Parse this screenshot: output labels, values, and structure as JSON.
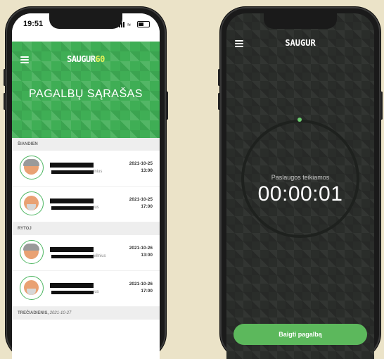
{
  "left_phone": {
    "status_time": "19:51",
    "logo_main": "SAUGUR",
    "logo_accent": "60",
    "page_title": "PAGALBŲ SĄRAŠAS",
    "sections": [
      {
        "label": "ŠIANDIEN",
        "items": [
          {
            "location": "lnius",
            "date": "2021-10-25",
            "time": "13:00",
            "avatar": "female-gray-hair"
          },
          {
            "location": "ius",
            "date": "2021-10-25",
            "time": "17:00",
            "avatar": "male-bald-beard"
          }
        ]
      },
      {
        "label": "RYTOJ",
        "items": [
          {
            "location": "Vilnius",
            "date": "2021-10-26",
            "time": "13:00",
            "avatar": "female-gray-hair"
          },
          {
            "location": "ius",
            "date": "2021-10-26",
            "time": "17:00",
            "avatar": "male-bald-beard"
          }
        ]
      },
      {
        "label": "TREČIADIENIS,",
        "sub": "2021-10-27"
      }
    ]
  },
  "right_phone": {
    "logo_main": "SAUGUR",
    "timer_label": "Paslaugos teikiamos",
    "timer_value": "00:00:01",
    "finish_button": "Baigti pagalbą",
    "accent_color": "#5cb85c"
  }
}
